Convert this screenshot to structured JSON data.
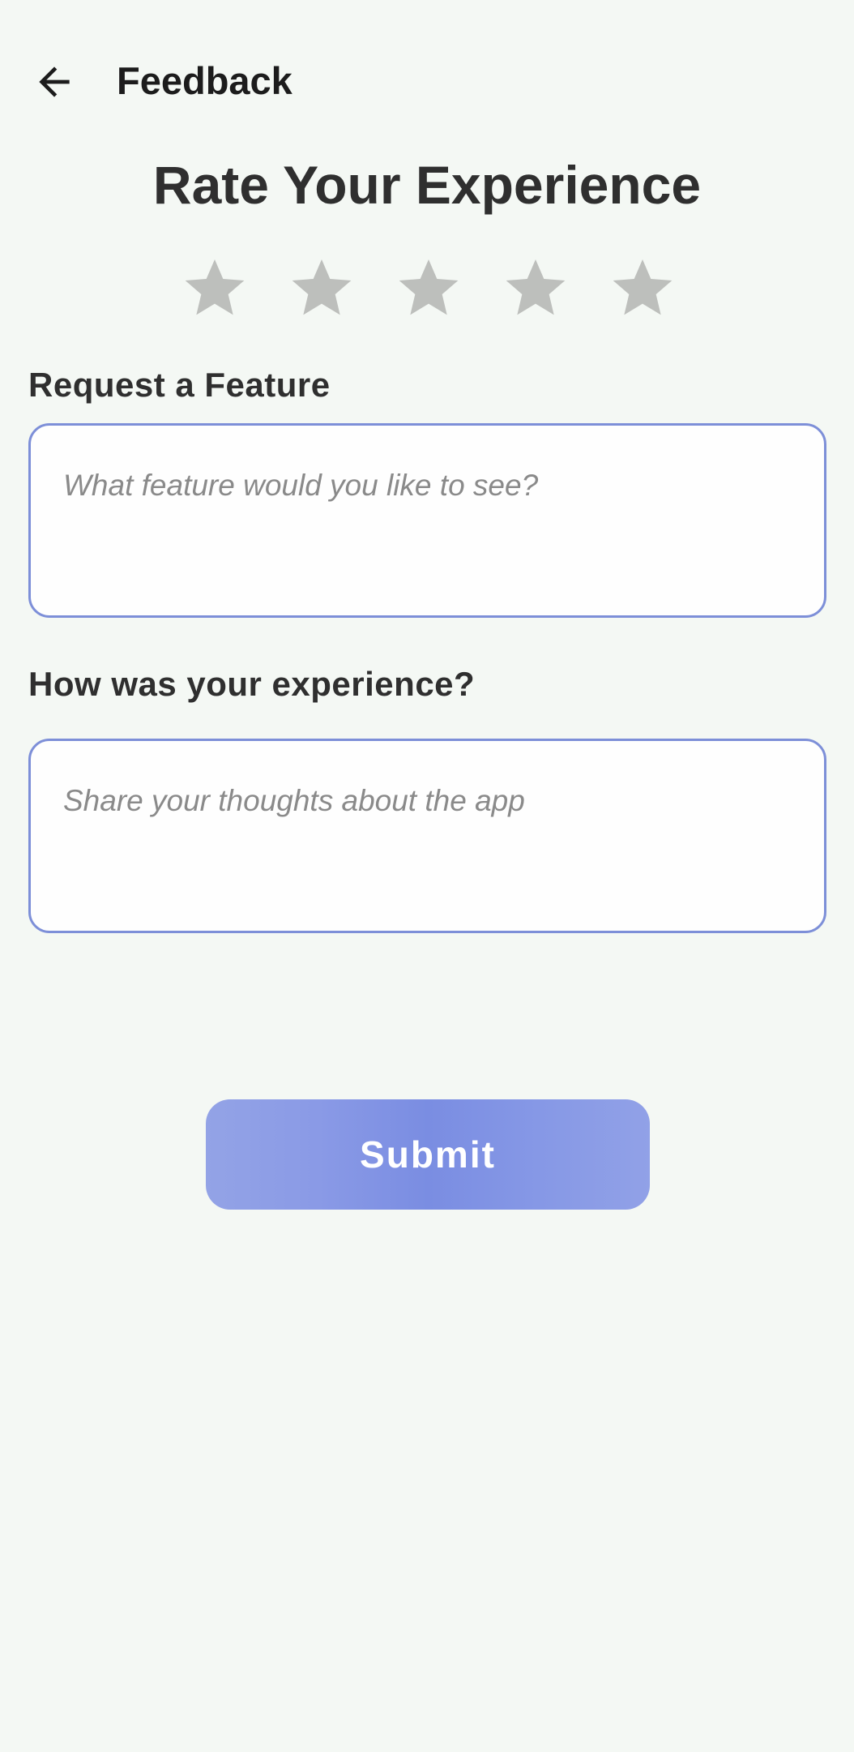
{
  "topbar": {
    "back_icon": "arrow-left-icon",
    "title": "Feedback"
  },
  "rating": {
    "heading": "Rate Your Experience",
    "max_stars": 5,
    "selected": 0,
    "star_icon": "star-icon",
    "empty_color": "#bdbfbc"
  },
  "feature_request": {
    "label": "Request a Feature",
    "value": "",
    "placeholder": "What feature would you like to see?"
  },
  "experience": {
    "label": "How was your experience?",
    "value": "",
    "placeholder": "Share your thoughts about the app"
  },
  "submit": {
    "label": "Submit"
  },
  "colors": {
    "background": "#f4f8f4",
    "accent": "#7d8fd8"
  }
}
